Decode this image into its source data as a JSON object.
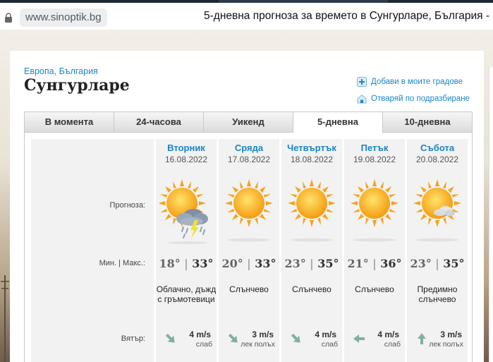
{
  "browser": {
    "url": "www.sinoptik.bg",
    "title": "5-дневна прогноза за времето в Сунгурларе, България -"
  },
  "location": {
    "breadcrumb_region": "Европа",
    "breadcrumb_sep": ",",
    "breadcrumb_country": "България",
    "city": "Сунгурларе"
  },
  "actions": {
    "add_city": "Добави в моите градове",
    "open_default": "Отваряй по подразбиране"
  },
  "tabs": [
    "В момента",
    "24-часова",
    "Уикенд",
    "5-дневна",
    "10-дневна"
  ],
  "active_tab": "5-дневна",
  "row_labels": {
    "forecast": "Прогноза:",
    "minmax": "Мин. | Макс.:",
    "wind": "Вятър:"
  },
  "days": [
    {
      "name": "Вторник",
      "date": "16.08.2022",
      "min": "18°",
      "sep": "|",
      "max": "33°",
      "cond": "Облачно, дъжд с гръмотевици",
      "icon": "sun-cloud-thunderstorm-icon",
      "wind_speed": "4 m/s",
      "wind_desc": "слаб",
      "wind_dir": "southeast-arrow-icon"
    },
    {
      "name": "Сряда",
      "date": "17.08.2022",
      "min": "20°",
      "sep": "|",
      "max": "33°",
      "cond": "Слънчево",
      "icon": "sun-icon",
      "wind_speed": "3 m/s",
      "wind_desc": "лек полъх",
      "wind_dir": "southeast-arrow-icon"
    },
    {
      "name": "Четвъртък",
      "date": "18.08.2022",
      "min": "23°",
      "sep": "|",
      "max": "35°",
      "cond": "Слънчево",
      "icon": "sun-icon",
      "wind_speed": "4 m/s",
      "wind_desc": "слаб",
      "wind_dir": "southeast-arrow-icon"
    },
    {
      "name": "Петък",
      "date": "19.08.2022",
      "min": "21°",
      "sep": "|",
      "max": "36°",
      "cond": "Слънчево",
      "icon": "sun-icon",
      "wind_speed": "4 m/s",
      "wind_desc": "слаб",
      "wind_dir": "west-arrow-icon"
    },
    {
      "name": "Събота",
      "date": "20.08.2022",
      "min": "23°",
      "sep": "|",
      "max": "35°",
      "cond": "Предимно слънчево",
      "icon": "sun-small-cloud-icon",
      "wind_speed": "3 m/s",
      "wind_desc": "лек полъх",
      "wind_dir": "north-arrow-icon"
    }
  ],
  "colors": {
    "link": "#1a86c8",
    "sun": "#f7a81b",
    "panel_bg": "#f2f2f2"
  }
}
